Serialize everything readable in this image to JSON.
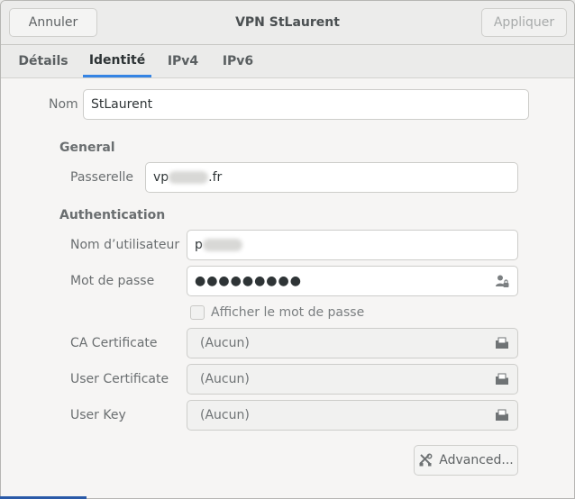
{
  "window": {
    "title": "VPN StLaurent",
    "cancel_label": "Annuler",
    "apply_label": "Appliquer"
  },
  "tabs": [
    {
      "label": "Détails",
      "active": false
    },
    {
      "label": "Identité",
      "active": true
    },
    {
      "label": "IPv4",
      "active": false
    },
    {
      "label": "IPv6",
      "active": false
    }
  ],
  "name": {
    "label": "Nom",
    "value": "StLaurent"
  },
  "general": {
    "heading": "General",
    "gateway_label": "Passerelle",
    "gateway_prefix": "vp",
    "gateway_suffix": ".fr"
  },
  "auth": {
    "heading": "Authentication",
    "username_label": "Nom d’utilisateur",
    "username_prefix": "p",
    "password_label": "Mot de passe",
    "password_value": "●●●●●●●●●",
    "show_password_label": "Afficher le mot de passe",
    "ca_label": "CA Certificate",
    "ca_value": "(Aucun)",
    "user_cert_label": "User Certificate",
    "user_cert_value": "(Aucun)",
    "user_key_label": "User Key",
    "user_key_value": "(Aucun)",
    "advanced_label": "Advanced..."
  },
  "colors": {
    "accent": "#3584e4"
  },
  "icons": {
    "password_storage": "user-lock-icon",
    "file_chooser": "folder-document-icon",
    "advanced": "tools-icon"
  }
}
